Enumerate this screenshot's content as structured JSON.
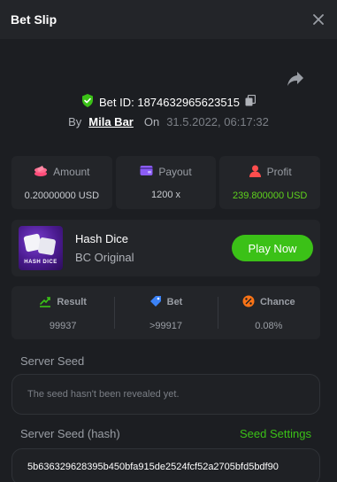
{
  "header": {
    "title": "Bet Slip"
  },
  "bet": {
    "id_label": "Bet ID: 1874632965623515",
    "by_label": "By",
    "user": "Mila Bar",
    "on_label": "On",
    "datetime": "31.5.2022, 06:17:32"
  },
  "stats": [
    {
      "label": "Amount",
      "value": "0.20000000 USD",
      "icon": "coins-icon"
    },
    {
      "label": "Payout",
      "value": "1200 x",
      "icon": "wallet-icon"
    },
    {
      "label": "Profit",
      "value": "239.800000 USD",
      "icon": "user-profit-icon"
    }
  ],
  "game": {
    "name": "Hash Dice",
    "provider": "BC Original",
    "thumb_label": "HASH DICE",
    "play_label": "Play Now"
  },
  "results": [
    {
      "label": "Result",
      "value": "99937",
      "icon": "result-icon"
    },
    {
      "label": "Bet",
      "value": ">99917",
      "icon": "bet-icon"
    },
    {
      "label": "Chance",
      "value": "0.08%",
      "icon": "chance-icon"
    }
  ],
  "seeds": {
    "server_seed_label": "Server Seed",
    "server_seed_value": "The seed hasn't been revealed yet.",
    "hash_label": "Server Seed (hash)",
    "settings_label": "Seed Settings",
    "hash_value": "5b636329628395b450bfa915de2524fcf52a2705bfd5bdf90"
  },
  "colors": {
    "accent_green": "#3bc117",
    "profit_green": "#5ed21c",
    "background": "#1c1e22",
    "panel": "#232529"
  }
}
